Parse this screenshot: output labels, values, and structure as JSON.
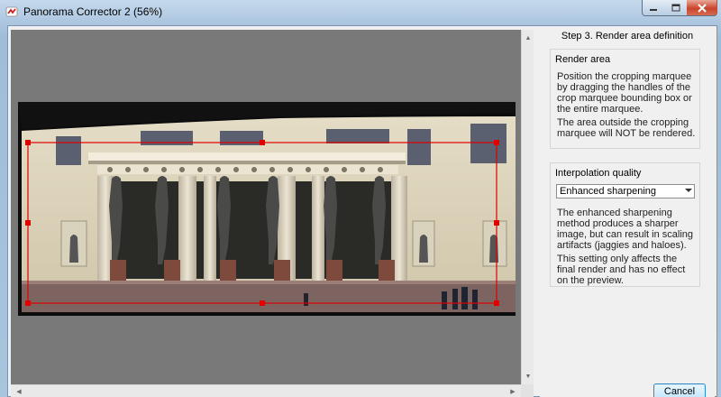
{
  "window": {
    "title": "Panorama Corrector 2 (56%)"
  },
  "preview": {
    "image_label": "panorama-photo"
  },
  "panel": {
    "step_title": "Step 3. Render area definition",
    "render_area": {
      "title": "Render area",
      "text1": "Position the cropping marquee by dragging the handles of the crop marquee bounding box or the entire marquee.",
      "text2": "The area outside the cropping marquee will NOT be rendered."
    },
    "interpolation": {
      "title": "Interpolation quality",
      "selected": "Enhanced sharpening",
      "text1": "The enhanced sharpening method produces a sharper image, but can result in scaling artifacts (jaggies and haloes).",
      "text2": "This setting only affects the final render and has no effect on the preview."
    },
    "cancel_label": "Cancel"
  },
  "colors": {
    "marquee": "#e00000",
    "preview_bg": "#797979"
  }
}
